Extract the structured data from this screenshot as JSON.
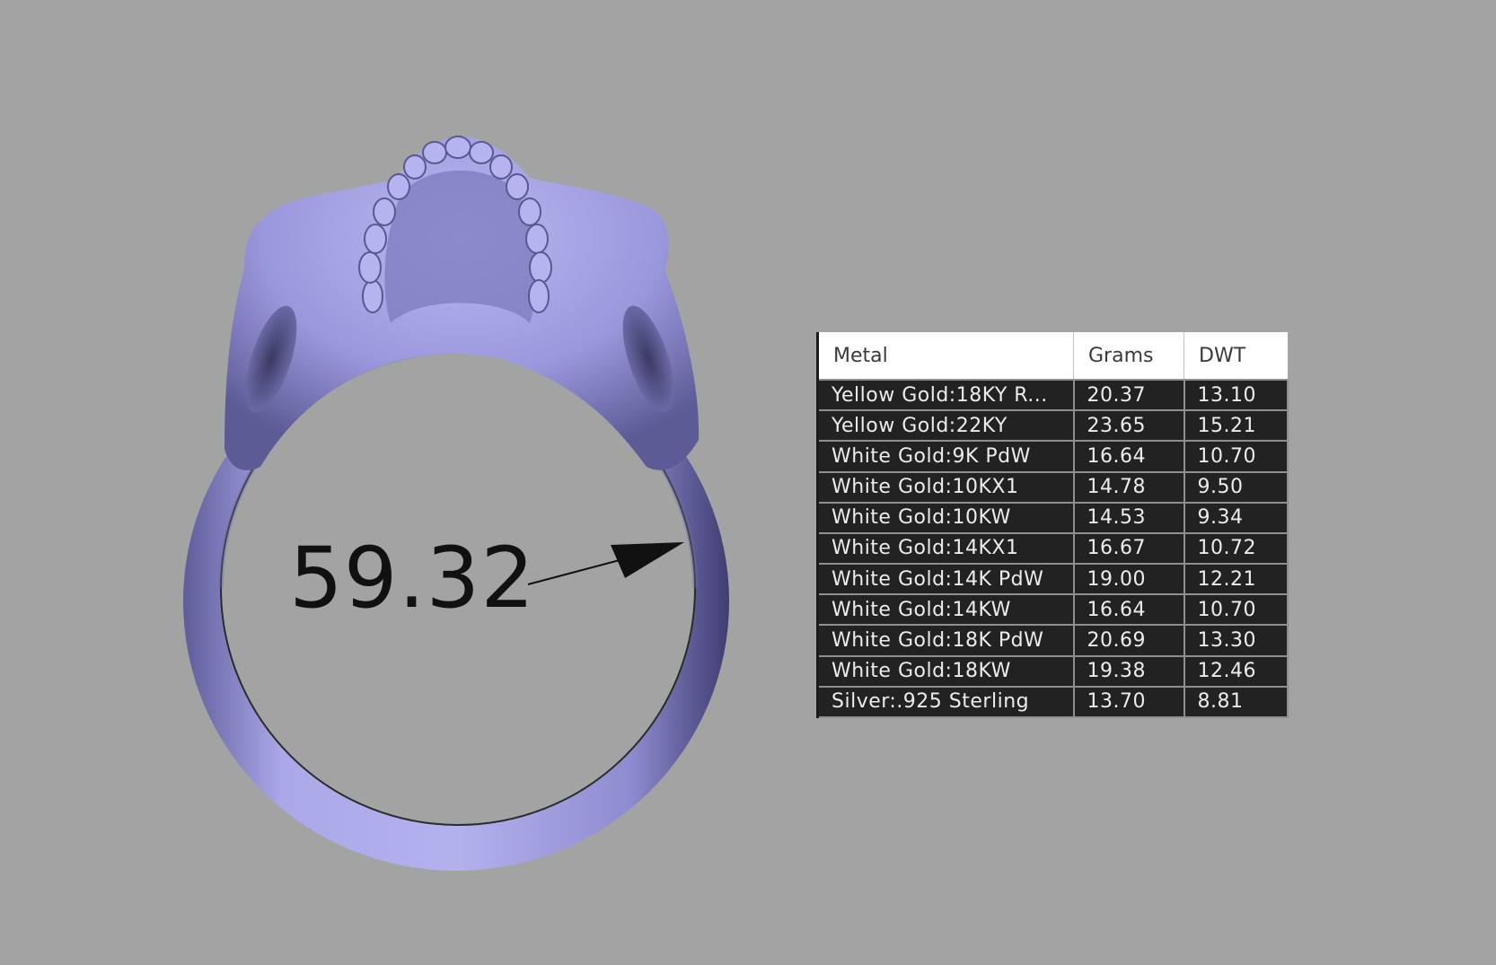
{
  "measurement": {
    "value": "59.32"
  },
  "weights_table": {
    "headers": [
      "Metal",
      "Grams",
      "DWT"
    ],
    "rows": [
      {
        "metal": "Yellow Gold:18KY R...",
        "grams": "20.37",
        "dwt": "13.10"
      },
      {
        "metal": "Yellow Gold:22KY",
        "grams": "23.65",
        "dwt": "15.21"
      },
      {
        "metal": "White Gold:9K PdW",
        "grams": "16.64",
        "dwt": "10.70"
      },
      {
        "metal": "White Gold:10KX1",
        "grams": "14.78",
        "dwt": "9.50"
      },
      {
        "metal": "White Gold:10KW",
        "grams": "14.53",
        "dwt": "9.34"
      },
      {
        "metal": "White Gold:14KX1",
        "grams": "16.67",
        "dwt": "10.72"
      },
      {
        "metal": "White Gold:14K PdW",
        "grams": "19.00",
        "dwt": "12.21"
      },
      {
        "metal": "White Gold:14KW",
        "grams": "16.64",
        "dwt": "10.70"
      },
      {
        "metal": "White Gold:18K PdW",
        "grams": "20.69",
        "dwt": "13.30"
      },
      {
        "metal": "White Gold:18KW",
        "grams": "19.38",
        "dwt": "12.46"
      },
      {
        "metal": "Silver:.925 Sterling",
        "grams": "13.70",
        "dwt": "8.81"
      }
    ]
  },
  "colors": {
    "background": "#a3a3a3",
    "ring_body": "#a9a7e6",
    "ring_shadow": "#5b5994",
    "table_row_bg": "#222222",
    "table_header_bg": "#ffffff"
  }
}
